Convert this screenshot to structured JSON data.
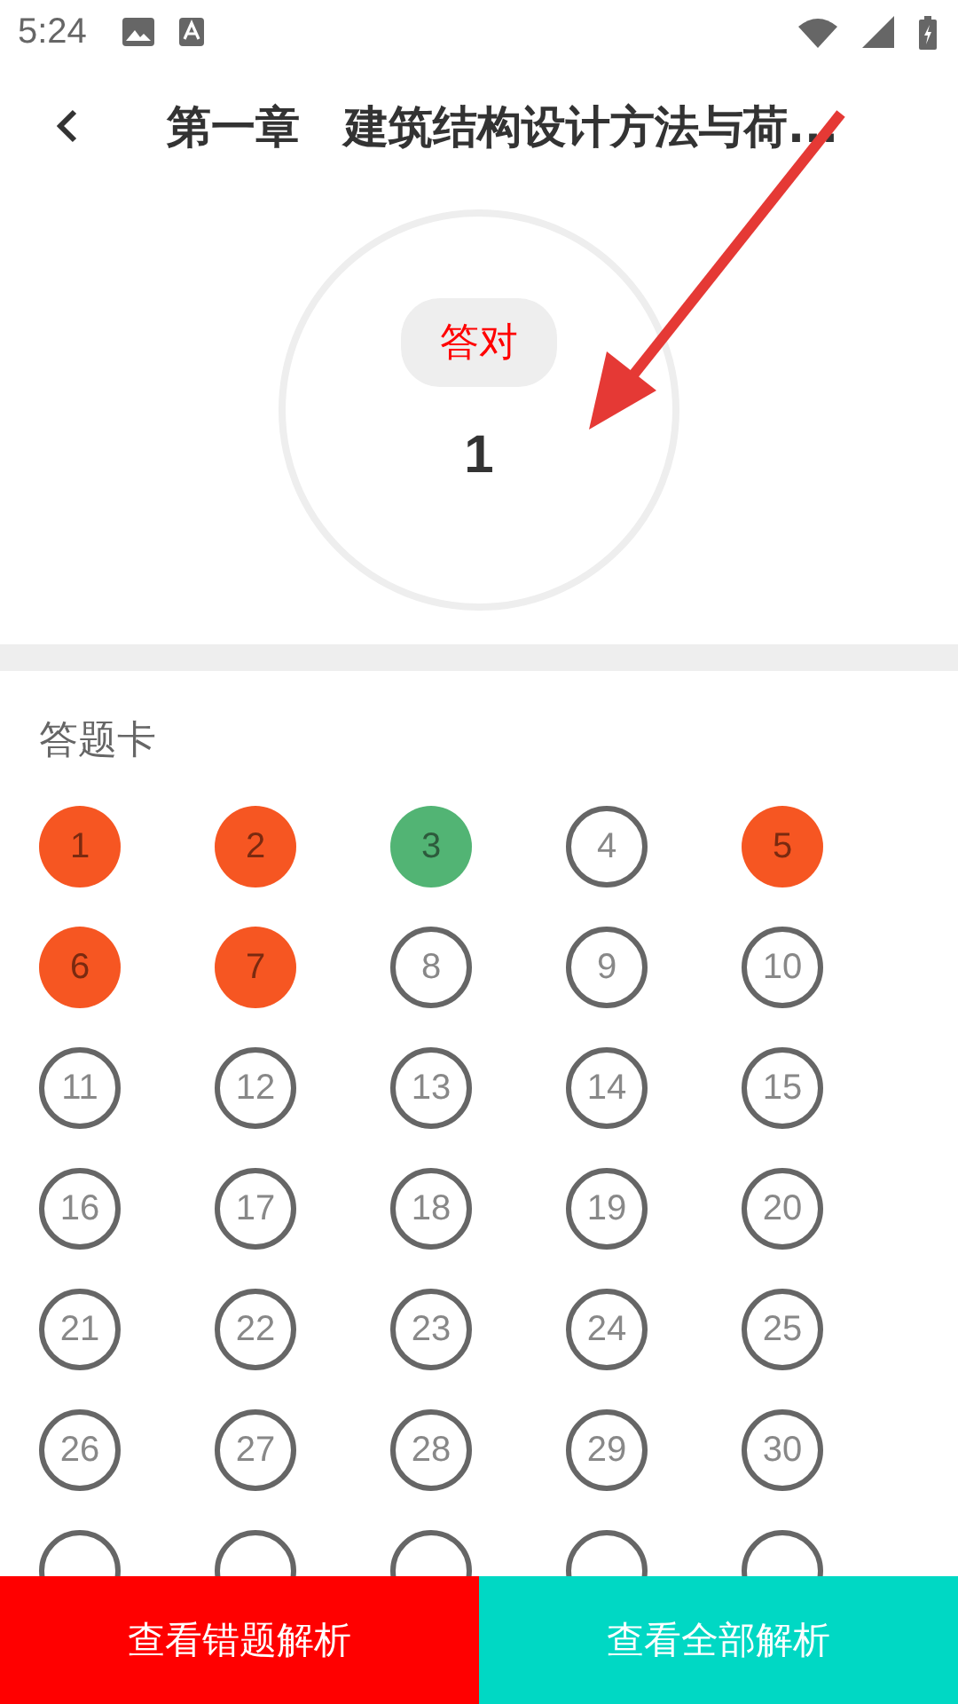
{
  "status_bar": {
    "time": "5:24"
  },
  "header": {
    "title": "第一章　建筑结构设计方法与荷..."
  },
  "score": {
    "label": "答对",
    "value": "1"
  },
  "answer_card": {
    "title": "答题卡",
    "items": [
      {
        "number": "1",
        "kind": "wrong"
      },
      {
        "number": "2",
        "kind": "wrong"
      },
      {
        "number": "3",
        "kind": "right"
      },
      {
        "number": "4",
        "kind": "unanswered"
      },
      {
        "number": "5",
        "kind": "wrong"
      },
      {
        "number": "6",
        "kind": "wrong"
      },
      {
        "number": "7",
        "kind": "wrong"
      },
      {
        "number": "8",
        "kind": "unanswered"
      },
      {
        "number": "9",
        "kind": "unanswered"
      },
      {
        "number": "10",
        "kind": "unanswered"
      },
      {
        "number": "11",
        "kind": "unanswered"
      },
      {
        "number": "12",
        "kind": "unanswered"
      },
      {
        "number": "13",
        "kind": "unanswered"
      },
      {
        "number": "14",
        "kind": "unanswered"
      },
      {
        "number": "15",
        "kind": "unanswered"
      },
      {
        "number": "16",
        "kind": "unanswered"
      },
      {
        "number": "17",
        "kind": "unanswered"
      },
      {
        "number": "18",
        "kind": "unanswered"
      },
      {
        "number": "19",
        "kind": "unanswered"
      },
      {
        "number": "20",
        "kind": "unanswered"
      },
      {
        "number": "21",
        "kind": "unanswered"
      },
      {
        "number": "22",
        "kind": "unanswered"
      },
      {
        "number": "23",
        "kind": "unanswered"
      },
      {
        "number": "24",
        "kind": "unanswered"
      },
      {
        "number": "25",
        "kind": "unanswered"
      },
      {
        "number": "26",
        "kind": "unanswered"
      },
      {
        "number": "27",
        "kind": "unanswered"
      },
      {
        "number": "28",
        "kind": "unanswered"
      },
      {
        "number": "29",
        "kind": "unanswered"
      },
      {
        "number": "30",
        "kind": "unanswered"
      }
    ]
  },
  "buttons": [
    "查看错题解析",
    "查看全部解析"
  ]
}
